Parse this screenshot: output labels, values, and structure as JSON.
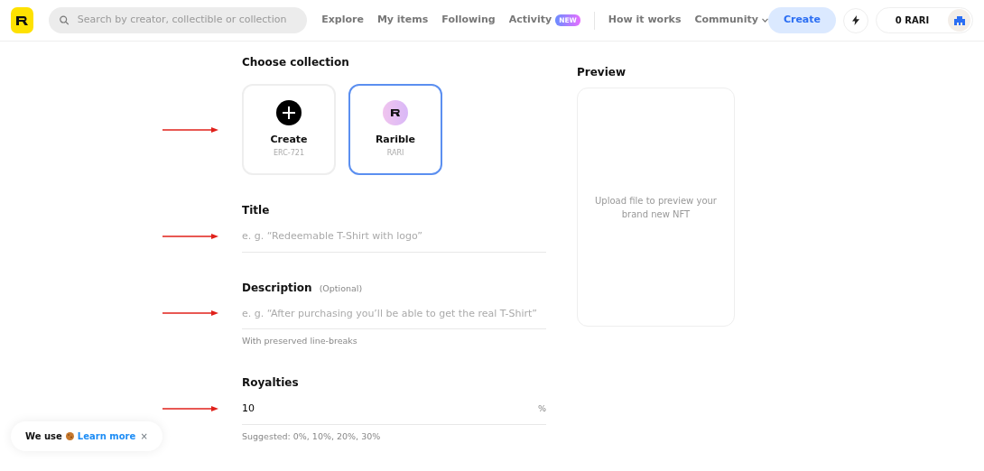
{
  "header": {
    "search": {
      "placeholder": "Search by creator, collectible or collection"
    },
    "nav": [
      {
        "label": "Explore"
      },
      {
        "label": "My items"
      },
      {
        "label": "Following"
      },
      {
        "label": "Activity",
        "badge": "NEW"
      },
      {
        "label": "How it works",
        "divider_before": true
      },
      {
        "label": "Community",
        "dropdown": true
      }
    ],
    "create_button": "Create",
    "balance": "0 RARI"
  },
  "collection": {
    "label": "Choose collection",
    "annotated": true,
    "options": [
      {
        "kind": "new",
        "name": "Create",
        "subtitle": "ERC-721",
        "selected": false
      },
      {
        "kind": "existing",
        "name": "Rarible",
        "subtitle": "RARI",
        "selected": true
      }
    ]
  },
  "fields": [
    {
      "label": "Title",
      "placeholder": "e. g. “Redeemable T-Shirt with logo”",
      "annotated": true
    },
    {
      "label": "Description",
      "note": "(Optional)",
      "placeholder": "e. g. “After purchasing you’ll be able to get the real T-Shirt”",
      "help": "With preserved line-breaks",
      "annotated": true
    },
    {
      "label": "Royalties",
      "value": "10",
      "suffix": "%",
      "help": "Suggested: 0%, 10%, 20%, 30%",
      "annotated": true
    }
  ],
  "preview": {
    "label": "Preview",
    "message": "Upload file to preview your brand new NFT"
  },
  "cookie_toast": {
    "text": "We use",
    "link": "Learn more",
    "close": "×"
  }
}
